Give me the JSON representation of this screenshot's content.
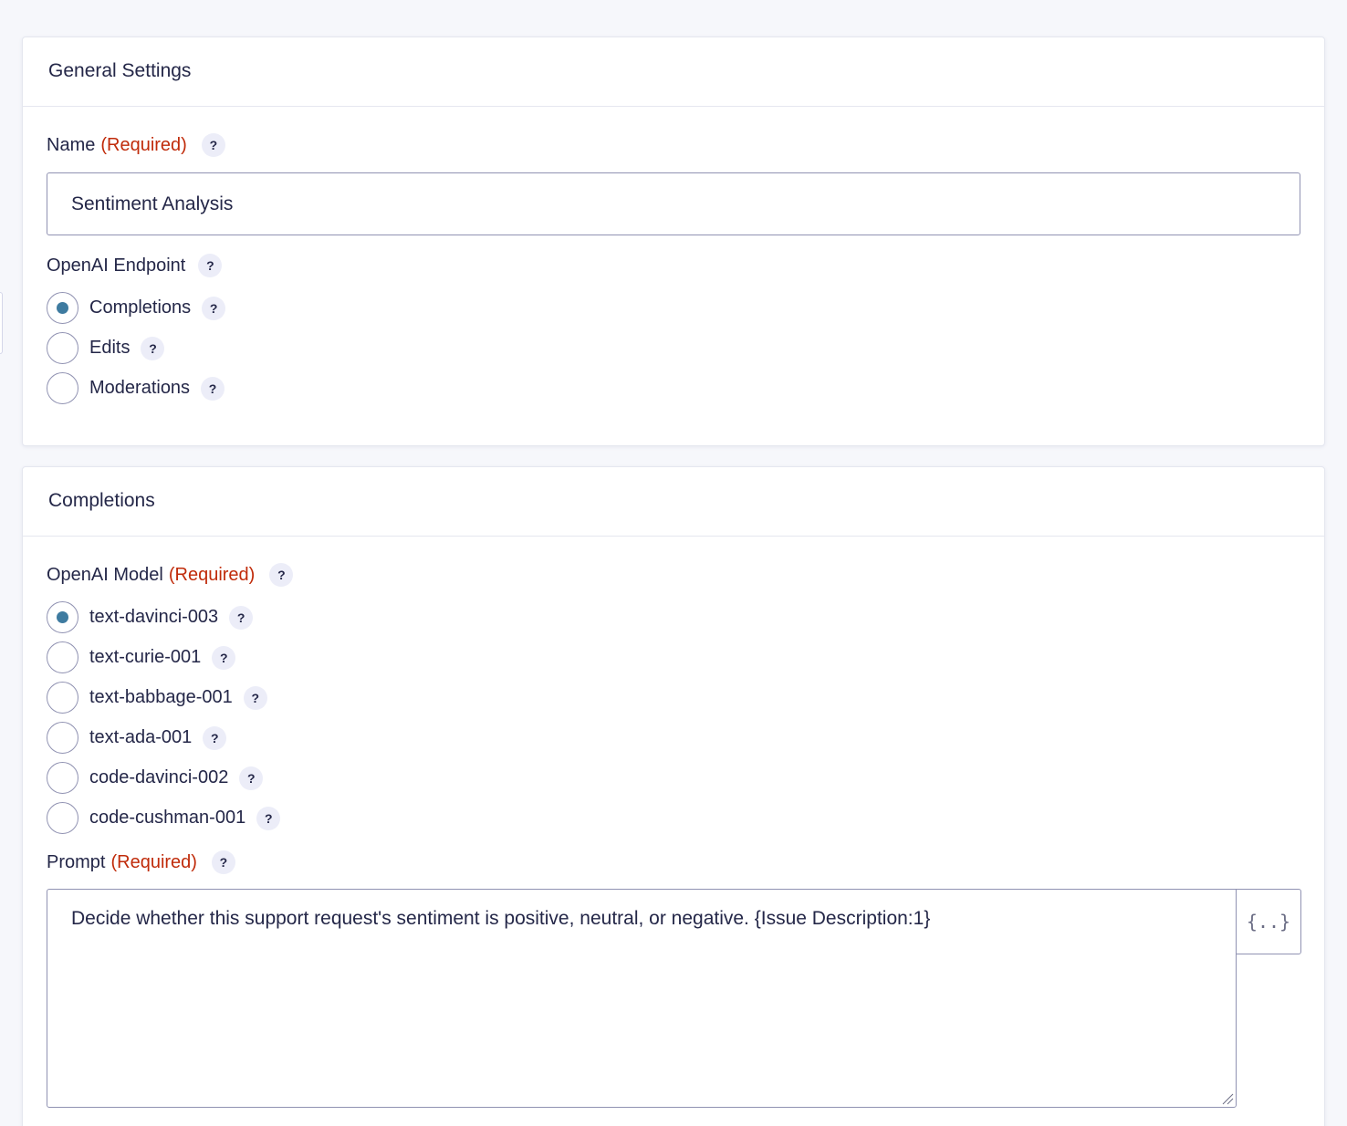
{
  "general": {
    "title": "General Settings",
    "name": {
      "label": "Name",
      "required": "(Required)",
      "value": "Sentiment Analysis"
    },
    "endpoint": {
      "label": "OpenAI Endpoint",
      "options": [
        "Completions",
        "Edits",
        "Moderations"
      ],
      "selected": "Completions"
    }
  },
  "completions": {
    "title": "Completions",
    "model": {
      "label": "OpenAI Model",
      "required": "(Required)",
      "options": [
        "text-davinci-003",
        "text-curie-001",
        "text-babbage-001",
        "text-ada-001",
        "code-davinci-002",
        "code-cushman-001"
      ],
      "selected": "text-davinci-003"
    },
    "prompt": {
      "label": "Prompt",
      "required": "(Required)",
      "value": "Decide whether this support request's sentiment is positive, neutral, or negative. {Issue Description:1}",
      "merge_tag_icon": "{..}"
    }
  },
  "help_glyph": "?",
  "colors": {
    "required": "#c02b0a",
    "radio_selected": "#3e7ba0",
    "help_bg": "#ecedf8"
  }
}
